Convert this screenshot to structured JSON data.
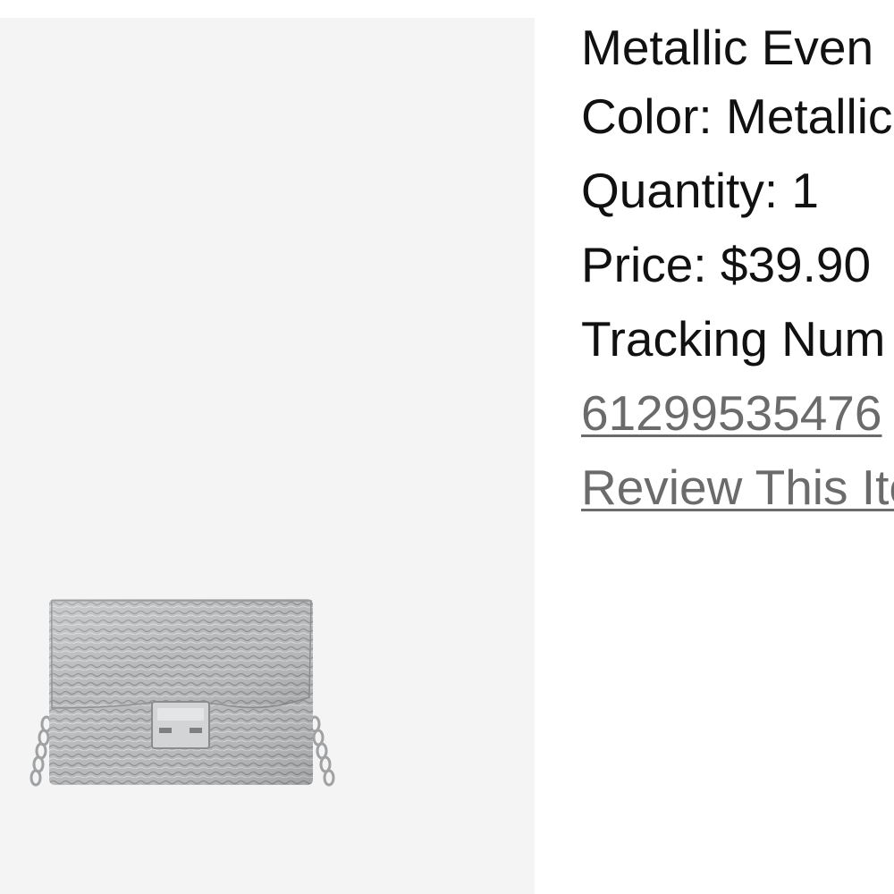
{
  "order_item": {
    "product_name": "Metallic Even",
    "color_label": "Color:",
    "color_value": "Metallic",
    "quantity_label": "Quantity:",
    "quantity_value": "1",
    "price_label": "Price:",
    "price_value": "$39.90",
    "tracking_label": "Tracking Num",
    "tracking_number": "61299535476",
    "review_link": "Review This Ite"
  },
  "colors": {
    "image_background": "#f4f4f4",
    "text": "#111111",
    "link": "#6b6b6b",
    "bag_metal": "#a9abad"
  },
  "image": {
    "subject": "metallic-chain-crossbody-bag"
  }
}
